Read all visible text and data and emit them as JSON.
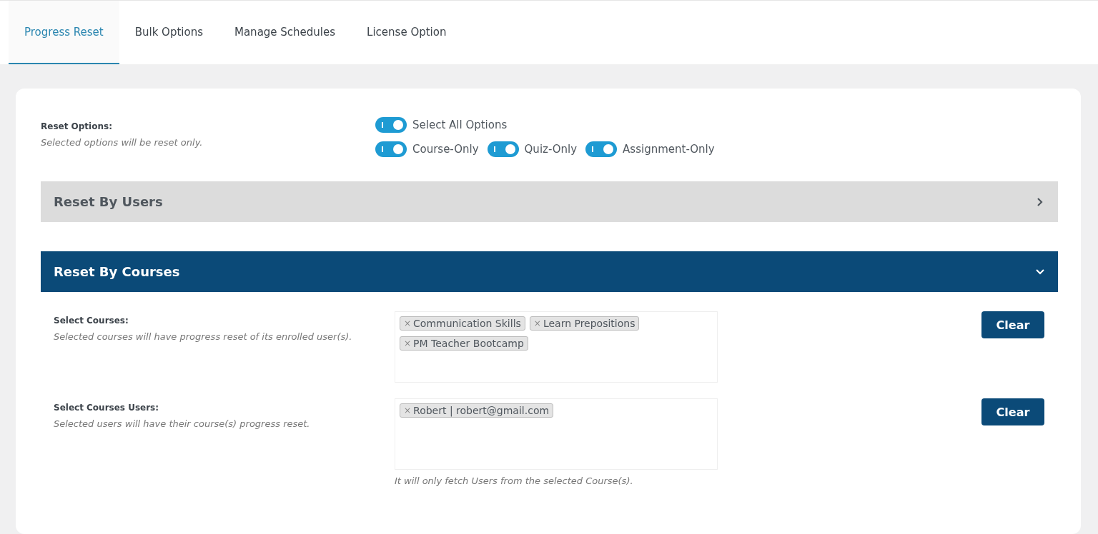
{
  "tabs": [
    {
      "label": "Progress Reset",
      "selected": true
    },
    {
      "label": "Bulk Options",
      "selected": false
    },
    {
      "label": "Manage Schedules",
      "selected": false
    },
    {
      "label": "License Option",
      "selected": false
    }
  ],
  "reset_options": {
    "label": "Reset Options:",
    "hint": "Selected options will be reset only.",
    "toggle_rows": [
      [
        {
          "label": "Select All Options",
          "on": true
        }
      ],
      [
        {
          "label": "Course-Only",
          "on": true
        },
        {
          "label": "Quiz-Only",
          "on": true
        },
        {
          "label": "Assignment-Only",
          "on": true
        }
      ]
    ]
  },
  "sections": [
    {
      "title": "Reset By Users",
      "expanded": false
    },
    {
      "title": "Reset By Courses",
      "expanded": true,
      "fields": [
        {
          "label": "Select Courses:",
          "hint": "Selected courses will have progress reset of its enrolled user(s).",
          "tags": [
            {
              "remove": "×",
              "label": "Communication Skills"
            },
            {
              "remove": "×",
              "label": "Learn Prepositions"
            },
            {
              "remove": "×",
              "label": "PM Teacher Bootcamp"
            }
          ],
          "button": "Clear"
        },
        {
          "label": "Select Courses Users:",
          "hint": "Selected users will have their course(s) progress reset.",
          "tags": [
            {
              "remove": "×",
              "label": "Robert | robert@gmail.com"
            }
          ],
          "button": "Clear",
          "note": "It will only fetch Users from the selected Course(s)."
        }
      ]
    }
  ]
}
